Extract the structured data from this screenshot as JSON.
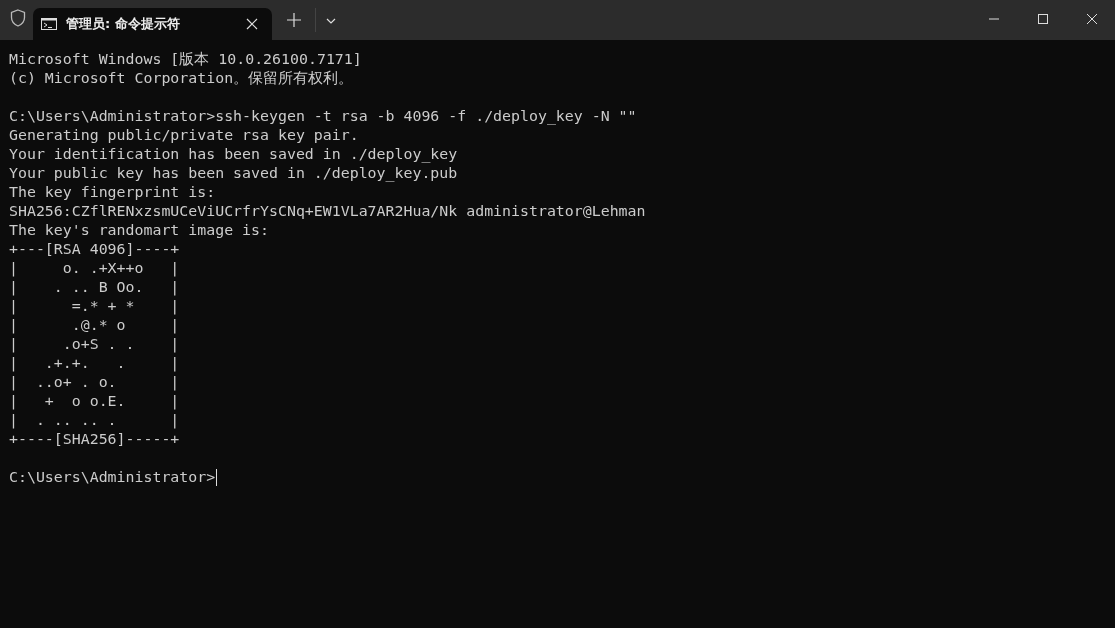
{
  "tab": {
    "title": "管理员: 命令提示符",
    "selected": true
  },
  "blocks": [
    [
      "Microsoft Windows [版本 10.0.26100.7171]",
      "(c) Microsoft Corporation。保留所有权利。"
    ],
    [
      "C:\\Users\\Administrator>ssh-keygen -t rsa -b 4096 -f ./deploy_key -N \"\"",
      "Generating public/private rsa key pair.",
      "Your identification has been saved in ./deploy_key",
      "Your public key has been saved in ./deploy_key.pub",
      "The key fingerprint is:",
      "SHA256:CZflRENxzsmUCeViUCrfrYsCNq+EW1VLa7AR2Hua/Nk administrator@Lehman",
      "The key's randomart image is:",
      "+---[RSA 4096]----+",
      "|     o. .+X++o   |",
      "|    . .. B Oo.   |",
      "|      =.* + *    |",
      "|      .@.* o     |",
      "|     .o+S . .    |",
      "|   .+.+.   .     |",
      "|  ..o+ . o.      |",
      "|   +  o o.E.     |",
      "|  . .. .. .      |",
      "+----[SHA256]-----+"
    ]
  ],
  "prompt": {
    "text": "C:\\Users\\Administrator>",
    "cursor": true
  }
}
